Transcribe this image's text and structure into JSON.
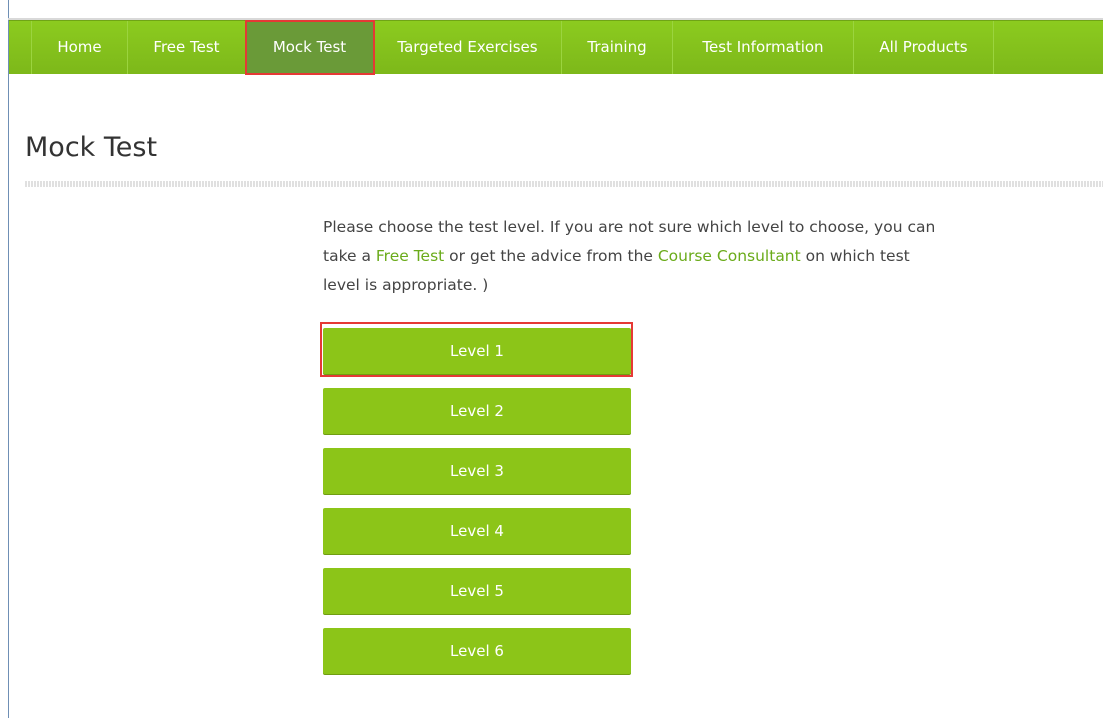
{
  "nav": {
    "items": [
      {
        "label": "Home"
      },
      {
        "label": "Free Test"
      },
      {
        "label": "Mock Test"
      },
      {
        "label": "Targeted Exercises"
      },
      {
        "label": "Training"
      },
      {
        "label": "Test Information"
      },
      {
        "label": "All Products"
      }
    ],
    "active": "Mock Test"
  },
  "page": {
    "title": "Mock Test",
    "intro": {
      "part1": "Please choose the test level. If you are not sure which level to choose, you can take a ",
      "link1": "Free Test",
      "part2": " or get the advice from the ",
      "link2": "Course Consultant",
      "part3": " on which test level is appropriate. )"
    },
    "levels": [
      "Level 1",
      "Level 2",
      "Level 3",
      "Level 4",
      "Level 5",
      "Level 6"
    ]
  },
  "colors": {
    "nav_green": "#8ccb1f",
    "button_green": "#8cc518",
    "link_green": "#6aab1a",
    "highlight_red": "#e53935"
  }
}
